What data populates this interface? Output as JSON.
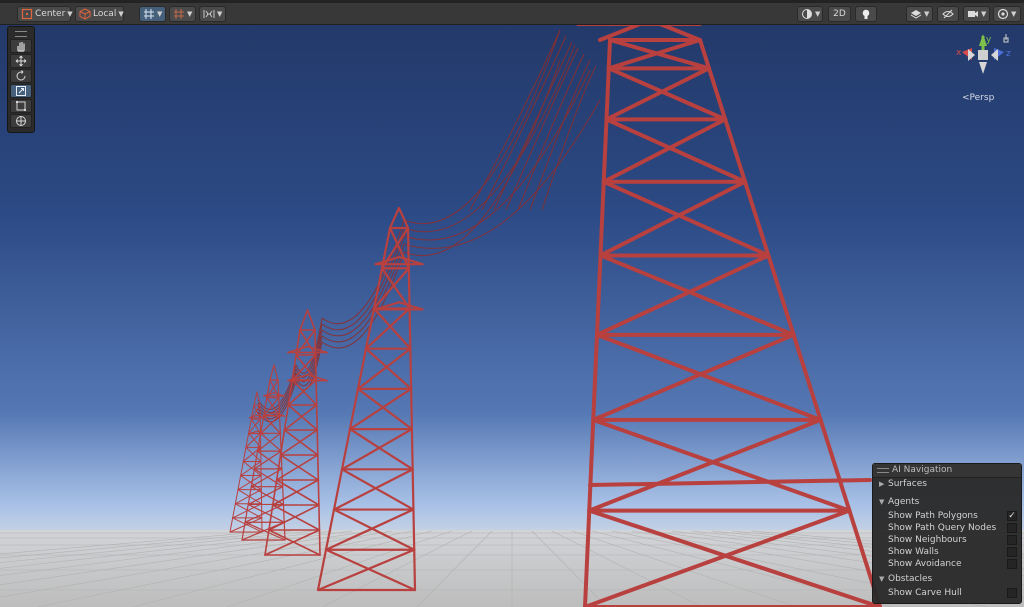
{
  "toolbar": {
    "pivot_label": "Center",
    "space_label": "Local",
    "mode_2d_label": "2D"
  },
  "tools": [
    "hand-tool",
    "move-tool",
    "rotate-tool",
    "scale-tool",
    "rect-tool",
    "transform-tool"
  ],
  "gizmo": {
    "projection_label": "<Persp",
    "axis_x": "x",
    "axis_y": "y",
    "axis_z": "z"
  },
  "overlay": {
    "title": "AI Navigation",
    "sections": [
      {
        "label": "Surfaces",
        "expanded": false
      },
      {
        "label": "Agents",
        "expanded": true
      },
      {
        "label": "Obstacles",
        "expanded": true
      }
    ],
    "agent_options": [
      {
        "label": "Show Path Polygons",
        "checked": true
      },
      {
        "label": "Show Path Query Nodes",
        "checked": false
      },
      {
        "label": "Show Neighbours",
        "checked": false
      },
      {
        "label": "Show Walls",
        "checked": false
      },
      {
        "label": "Show Avoidance",
        "checked": false
      }
    ],
    "obstacle_options": [
      {
        "label": "Show Carve Hull",
        "checked": false
      }
    ]
  },
  "colors": {
    "tower": "#b8403f",
    "sky_top": "#223766",
    "sky_horizon": "#a8bfe3",
    "ground": "#cfcfcf",
    "toolbar": "#383838",
    "accent": "#46607c"
  }
}
